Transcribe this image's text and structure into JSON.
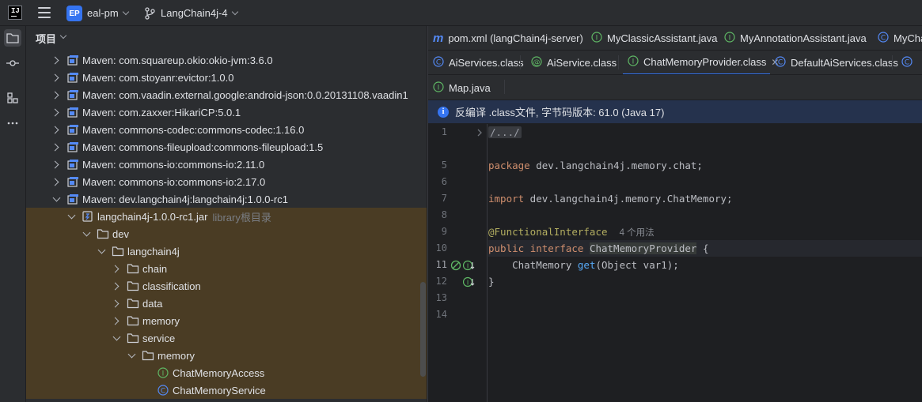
{
  "titlebar": {
    "project_badge": "EP",
    "project_name": "eal-pm",
    "branch_name": "LangChain4j-4"
  },
  "project_panel": {
    "title": "项目",
    "rows": [
      {
        "label": "Maven: com.squareup.okio:okio-jvm:3.6.0"
      },
      {
        "label": "Maven: com.stoyanr:evictor:1.0.0"
      },
      {
        "label": "Maven: com.vaadin.external.google:android-json:0.0.20131108.vaadin1"
      },
      {
        "label": "Maven: com.zaxxer:HikariCP:5.0.1"
      },
      {
        "label": "Maven: commons-codec:commons-codec:1.16.0"
      },
      {
        "label": "Maven: commons-fileupload:commons-fileupload:1.5"
      },
      {
        "label": "Maven: commons-io:commons-io:2.11.0"
      },
      {
        "label": "Maven: commons-io:commons-io:2.17.0"
      },
      {
        "label": "Maven: dev.langchain4j:langchain4j:1.0.0-rc1"
      },
      {
        "label": "langchain4j-1.0.0-rc1.jar",
        "suffix": "library根目录"
      },
      {
        "label": "dev"
      },
      {
        "label": "langchain4j"
      },
      {
        "label": "chain"
      },
      {
        "label": "classification"
      },
      {
        "label": "data"
      },
      {
        "label": "memory"
      },
      {
        "label": "service"
      },
      {
        "label": "memory"
      },
      {
        "label": "ChatMemoryAccess"
      },
      {
        "label": "ChatMemoryService"
      }
    ]
  },
  "editor": {
    "tabs_row1": [
      "pom.xml (langChain4j-server)",
      "MyClassicAssistant.java",
      "MyAnnotationAssistant.java",
      "MyCha"
    ],
    "tabs_row2": [
      "AiServices.class",
      "AiService.class",
      "ChatMemoryProvider.class",
      "DefaultAiServices.class"
    ],
    "tabs_row3": [
      "Map.java"
    ],
    "banner": "反编译 .class文件, 字节码版本: 61.0 (Java 17)",
    "line_numbers": [
      "1",
      "5",
      "6",
      "7",
      "8",
      "9",
      "10",
      "11",
      "12",
      "13",
      "14"
    ],
    "code": {
      "fold": "/.../",
      "package_kw": "package",
      "package_name": " dev.langchain4j.memory.chat;",
      "import_kw": "import",
      "import_name": " dev.langchain4j.memory.ChatMemory;",
      "annotation": "@FunctionalInterface",
      "usages": "4 个用法",
      "public_kw": "public",
      "interface_kw": "interface",
      "iface_name": "ChatMemoryProvider",
      "open_brace": " {",
      "method_ret": "    ChatMemory ",
      "method_name": "get",
      "method_args": "(Object var1);",
      "close_brace": "}"
    }
  },
  "colors": {
    "accent": "#3574f0",
    "highlight_row": "#4a3c24",
    "keyword": "#cf8e6d",
    "annotation": "#b3ae60",
    "function": "#56a8f5",
    "interface_icon": "#5fb865",
    "class_icon": "#548af7"
  }
}
